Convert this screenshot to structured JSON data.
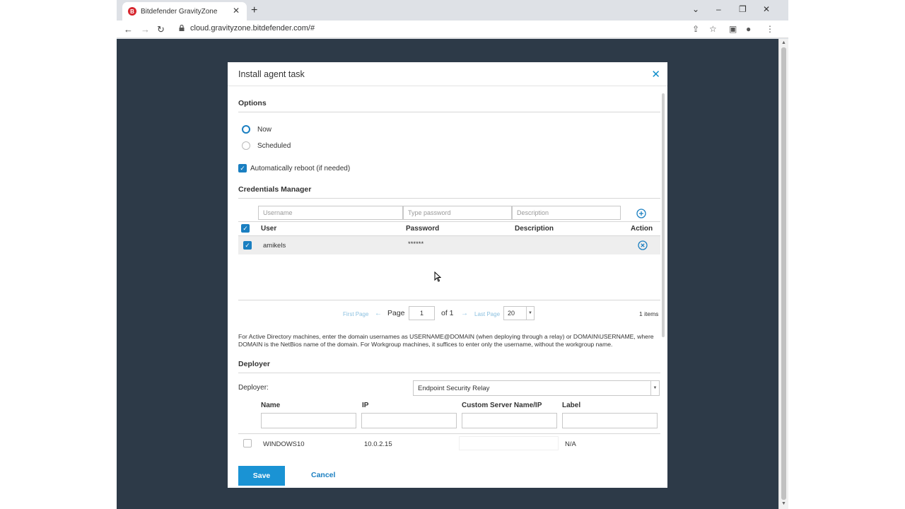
{
  "browser": {
    "tab_title": "Bitdefender GravityZone",
    "tab_favicon_letter": "B",
    "url": "cloud.gravityzone.bitdefender.com/#",
    "new_tab": "+",
    "tab_close": "✕",
    "win_min": "–",
    "win_max": "❐",
    "win_close": "✕",
    "win_chevron": "⌄"
  },
  "modal": {
    "title": "Install agent task",
    "close_icon": "✕",
    "options": {
      "heading": "Options",
      "now_label": "Now",
      "scheduled_label": "Scheduled",
      "selected": "Now",
      "reboot_label": "Automatically reboot (if needed)",
      "reboot_checked": true
    },
    "credentials": {
      "heading": "Credentials Manager",
      "username_placeholder": "Username",
      "password_placeholder": "Type password",
      "description_placeholder": "Description",
      "columns": [
        "User",
        "Password",
        "Description",
        "Action"
      ],
      "rows": [
        {
          "user": "amikels",
          "password": "******",
          "description": "",
          "checked": true
        }
      ],
      "pager": {
        "first_page": "First Page",
        "prev": "←",
        "page_label": "Page",
        "page_value": "1",
        "of_label": "of 1",
        "next": "→",
        "last_page": "Last Page",
        "page_size": "20",
        "items": "1 items"
      },
      "help_text": "For Active Directory machines, enter the domain usernames as USERNAME@DOMAIN (when deploying through a relay) or DOMAIN\\USERNAME, where DOMAIN is the NetBios name of the domain. For Workgroup machines, it suffices to enter only the username, without the workgroup name."
    },
    "deployer": {
      "heading": "Deployer",
      "label": "Deployer:",
      "selected": "Endpoint Security Relay",
      "columns": [
        "Name",
        "IP",
        "Custom Server Name/IP",
        "Label"
      ],
      "rows": [
        {
          "name": "WINDOWS10",
          "ip": "10.0.2.15",
          "custom": "",
          "label": "N/A",
          "checked": false
        }
      ]
    },
    "save_label": "Save",
    "cancel_label": "Cancel"
  },
  "colors": {
    "accent": "#1a7fc1",
    "save_button": "#1a93d4",
    "backdrop": "#2d3a48"
  }
}
